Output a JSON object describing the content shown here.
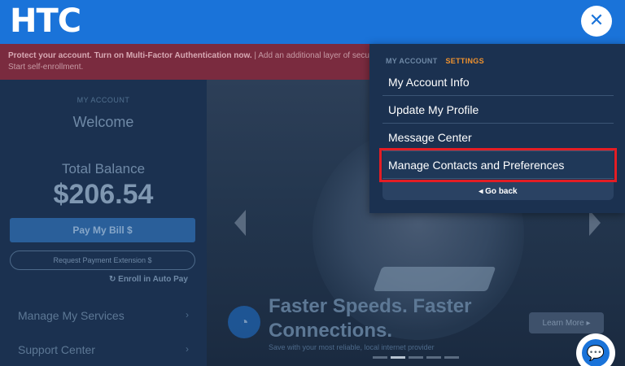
{
  "header": {
    "logo_text": "HTC",
    "close_icon_glyph": "✕",
    "brand_color": "#1a73d9"
  },
  "mfa_banner": {
    "bold_text": "Protect your account. Turn on Multi-Factor Authentication now.",
    "text": " | Add an additional layer of security. Verification options can be set up as text, email, or passcode. Start self-enrollment."
  },
  "account_panel": {
    "kicker": "MY ACCOUNT",
    "welcome": "Welcome",
    "total_label": "Total Balance",
    "total_amount": "$206.54",
    "pay_button": "Pay My Bill $",
    "extension_button": "Request Payment Extension $",
    "autopay_link": "↻ Enroll in Auto Pay",
    "nav": [
      {
        "label": "Manage My Services",
        "chevron": "›"
      },
      {
        "label": "Support Center",
        "chevron": "›"
      }
    ]
  },
  "hero": {
    "headline": "Faster Speeds. Faster Connections.",
    "subtext": "Save with your most reliable, local internet provider",
    "learn_more": "Learn More ▸",
    "wifi_icon_glyph": "◔",
    "carousel_active_index": 1,
    "carousel_count": 5
  },
  "menu": {
    "tab_account": "MY ACCOUNT",
    "tab_settings": "SETTINGS",
    "items": [
      {
        "label": "My Account Info"
      },
      {
        "label": "Update My Profile"
      },
      {
        "label": "Message Center"
      },
      {
        "label": "Manage Contacts and Preferences",
        "highlighted": true
      }
    ],
    "go_back": "◂ Go back",
    "highlight_color": "#e41d24",
    "settings_color": "#f0922e"
  },
  "chat": {
    "icon_glyph": "💬"
  }
}
